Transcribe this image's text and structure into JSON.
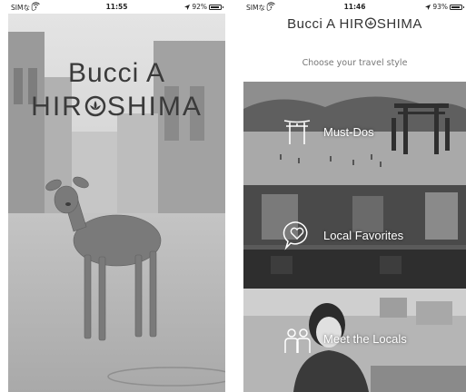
{
  "left_phone": {
    "status": {
      "carrier": "SIMなし",
      "time": "11:55",
      "battery_percent": "92%",
      "battery_level": 0.92
    },
    "logo": {
      "line1": "Bucci A",
      "line2_part1": "HIR",
      "line2_part2": "SHIMA"
    }
  },
  "right_phone": {
    "status": {
      "carrier": "SIMなし",
      "time": "11:46",
      "battery_percent": "93%",
      "battery_level": 0.93
    },
    "app_title": {
      "part1": "Bucci A HIR",
      "part2": "SHIMA"
    },
    "subtitle": "Choose your travel style",
    "cards": [
      {
        "label": "Must-Dos",
        "icon": "torii-gate-icon"
      },
      {
        "label": "Local Favorites",
        "icon": "heart-chat-icon"
      },
      {
        "label": "Meet the Locals",
        "icon": "people-icon"
      }
    ]
  },
  "colors": {
    "logo_text": "#3a3a3a",
    "subtitle": "#777777",
    "card_label": "#ffffff"
  }
}
